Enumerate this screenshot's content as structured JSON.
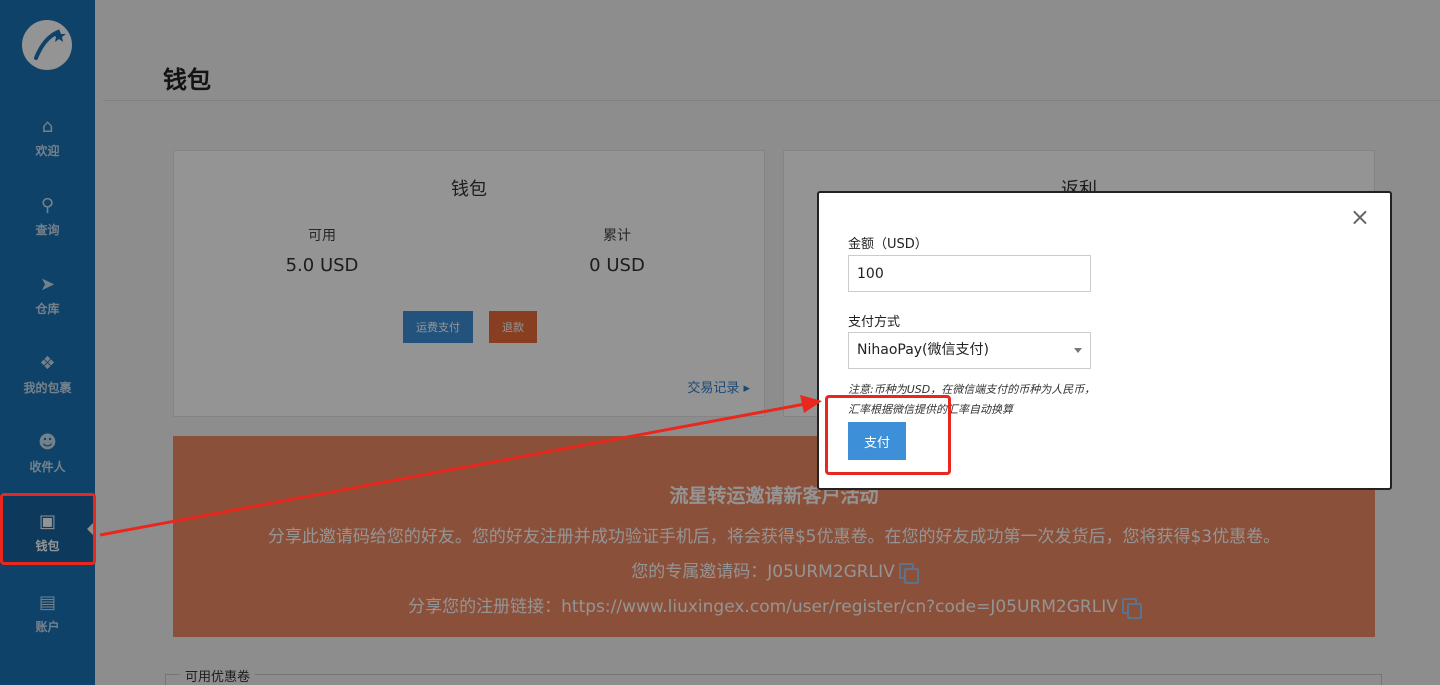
{
  "sidebar": {
    "items": [
      {
        "label": "欢迎",
        "icon": "home-icon",
        "glyph": "⌂"
      },
      {
        "label": "查询",
        "icon": "search-icon",
        "glyph": "⚲"
      },
      {
        "label": "仓库",
        "icon": "send-icon",
        "glyph": "➤"
      },
      {
        "label": "我的包裹",
        "icon": "packages-icon",
        "glyph": "❖"
      },
      {
        "label": "收件人",
        "icon": "users-icon",
        "glyph": "☻"
      },
      {
        "label": "钱包",
        "icon": "money-icon",
        "glyph": "▣"
      },
      {
        "label": "账户",
        "icon": "book-icon",
        "glyph": "▤"
      }
    ],
    "active_index": 5
  },
  "page": {
    "title": "钱包"
  },
  "wallet": {
    "title": "钱包",
    "available_label": "可用",
    "available_value": "5.0 USD",
    "total_label": "累计",
    "total_value": "0 USD",
    "pay_freight_label": "运费支付",
    "refund_label": "退款",
    "transactions_label": "交易记录 ▸"
  },
  "rebate": {
    "title": "返利"
  },
  "promo": {
    "title": "流星转运邀请新客户活动",
    "line1": "分享此邀请码给您的好友。您的好友注册并成功验证手机后，将会获得$5优惠卷。在您的好友成功第一次发货后，您将获得$3优惠卷。",
    "line2": "您的专属邀请码：J05URM2GRLIV",
    "line3": "分享您的注册链接：https://www.liuxingex.com/user/register/cn?code=J05URM2GRLIV"
  },
  "coupons": {
    "label": "可用优惠卷"
  },
  "modal": {
    "close": "×",
    "amount_label": "金额（USD）",
    "amount_value": "100",
    "method_label": "支付方式",
    "method_value": "NihaoPay(微信支付)",
    "note": "注意:币种为USD，在微信端支付的币种为人民币，汇率根据微信提供的汇率自动换算",
    "pay_label": "支付"
  },
  "colors": {
    "sidebar": "#1b72b5",
    "primary": "#3d8fd8",
    "orange": "#e86b3a",
    "promo": "#f08b63",
    "annotation": "#e8281e"
  }
}
